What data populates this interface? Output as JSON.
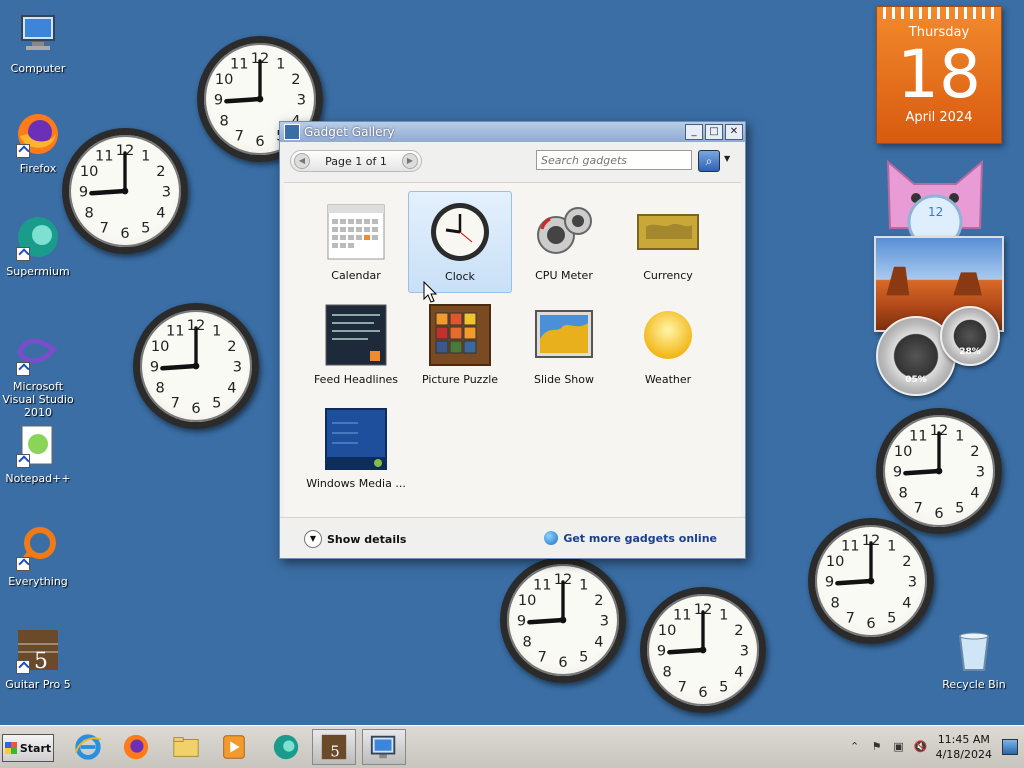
{
  "desktop": {
    "icons": [
      {
        "label": "Computer"
      },
      {
        "label": "Firefox"
      },
      {
        "label": "Supermium"
      },
      {
        "label": "Microsoft Visual Studio 2010"
      },
      {
        "label": "Notepad++"
      },
      {
        "label": "Everything"
      },
      {
        "label": "Guitar Pro 5"
      },
      {
        "label": "Recycle Bin"
      }
    ]
  },
  "calendar_gadget": {
    "weekday": "Thursday",
    "day": "18",
    "month_year": "April 2024"
  },
  "gallery": {
    "title": "Gadget Gallery",
    "page_label": "Page 1 of 1",
    "search_placeholder": "Search gadgets",
    "gadgets": [
      {
        "label": "Calendar"
      },
      {
        "label": "Clock"
      },
      {
        "label": "CPU Meter"
      },
      {
        "label": "Currency"
      },
      {
        "label": "Feed Headlines"
      },
      {
        "label": "Picture Puzzle"
      },
      {
        "label": "Slide Show"
      },
      {
        "label": "Weather"
      },
      {
        "label": "Windows Media ..."
      }
    ],
    "show_details": "Show details",
    "get_more": "Get more gadgets online"
  },
  "cpu_meter": {
    "cpu": "05%",
    "memory": "28%"
  },
  "taskbar": {
    "start_label": "Start",
    "time": "11:45 AM",
    "date": "4/18/2024"
  },
  "colors": {
    "desktop": "#3a6ea5",
    "calendar": "#e8731c",
    "link": "#1b3f8f"
  }
}
